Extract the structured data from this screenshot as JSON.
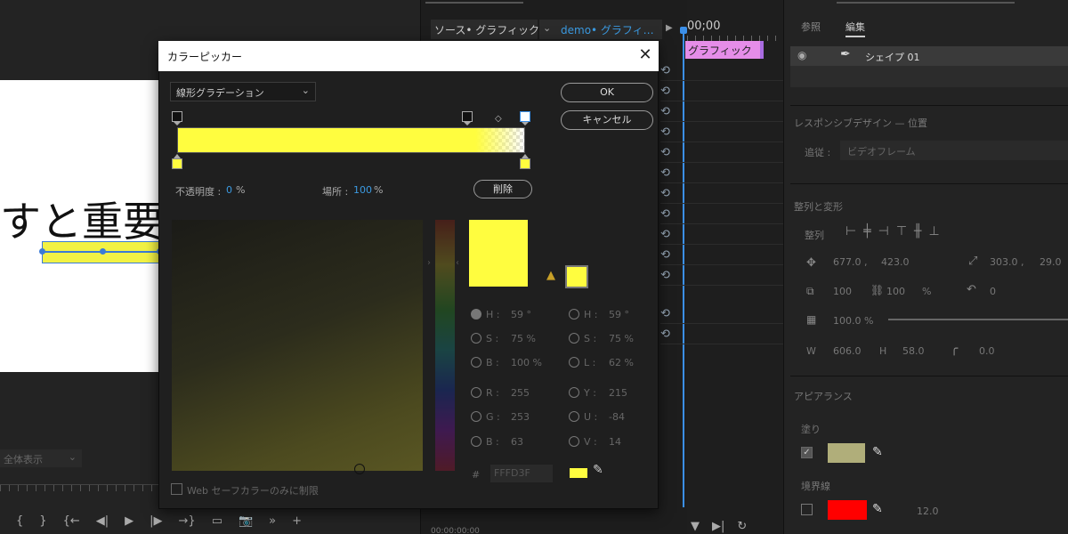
{
  "video": {
    "text": "すと重要な"
  },
  "monitor": {
    "zoom": "全体表示"
  },
  "transport": {
    "mark_in": "{",
    "mark_out": "}",
    "go_in": "{←",
    "step_back": "◀|",
    "play": "▶",
    "step_fwd": "|▶",
    "go_out": "→}",
    "lift": "▭",
    "camera": "📷",
    "add": "+",
    "more": "»"
  },
  "timeline": {
    "tab_source": "ソース• グラフィック",
    "tab_demo": "demo• グラフィ…",
    "time": "00;00",
    "clip": "グラフィック",
    "bottom_time": "00:00:00:00"
  },
  "right_panel": {
    "tab_browse": "参照",
    "tab_edit": "編集",
    "layer_name": "シェイプ 01",
    "responsive_heading": "レスポンシブデザイン — 位置",
    "follow_label": "追従 :",
    "follow_value": "ビデオフレーム",
    "align_heading": "整列と変形",
    "align_label": "整列",
    "pos_x": "677.0 ,",
    "pos_y": "423.0",
    "anchor_x": "303.0 ,",
    "anchor_y": "29.0",
    "scale": "100",
    "scale_pct": "100",
    "pct": "%",
    "rotation": "0",
    "opacity": "100.0 %",
    "w_label": "W",
    "w_value": "606.0",
    "h_label": "H",
    "h_value": "58.0",
    "radius": "0.0",
    "appearance_heading": "アピアランス",
    "fill_label": "塗り",
    "stroke_label": "境界線",
    "stroke_width": "12.0",
    "fill_color": "#b0ae7a",
    "stroke_color": "#ff0000"
  },
  "dialog": {
    "title": "カラーピッカー",
    "mode": "線形グラデーション",
    "ok": "OK",
    "cancel": "キャンセル",
    "delete": "削除",
    "opacity_label": "不透明度 :",
    "opacity_value": "0",
    "opacity_unit": "%",
    "location_label": "場所 :",
    "location_value": "100",
    "location_unit": "%",
    "hex_prefix": "#",
    "hex_value": "FFFD3F",
    "web_safe_label": "Web セーフカラーのみに制限",
    "current_color": "#fffd3f",
    "hsb": {
      "h_label": "H :",
      "h": "59 °",
      "s_label": "S :",
      "s": "75 %",
      "b_label": "B :",
      "b": "100 %"
    },
    "hsl": {
      "h_label": "H :",
      "h": "59 °",
      "s_label": "S :",
      "s": "75 %",
      "l_label": "L :",
      "l": "62 %"
    },
    "rgb": {
      "r_label": "R :",
      "r": "255",
      "g_label": "G :",
      "g": "253",
      "b_label": "B :",
      "b": "63"
    },
    "yuv": {
      "y_label": "Y :",
      "y": "215",
      "u_label": "U :",
      "u": "-84",
      "v_label": "V :",
      "v": "14"
    }
  }
}
